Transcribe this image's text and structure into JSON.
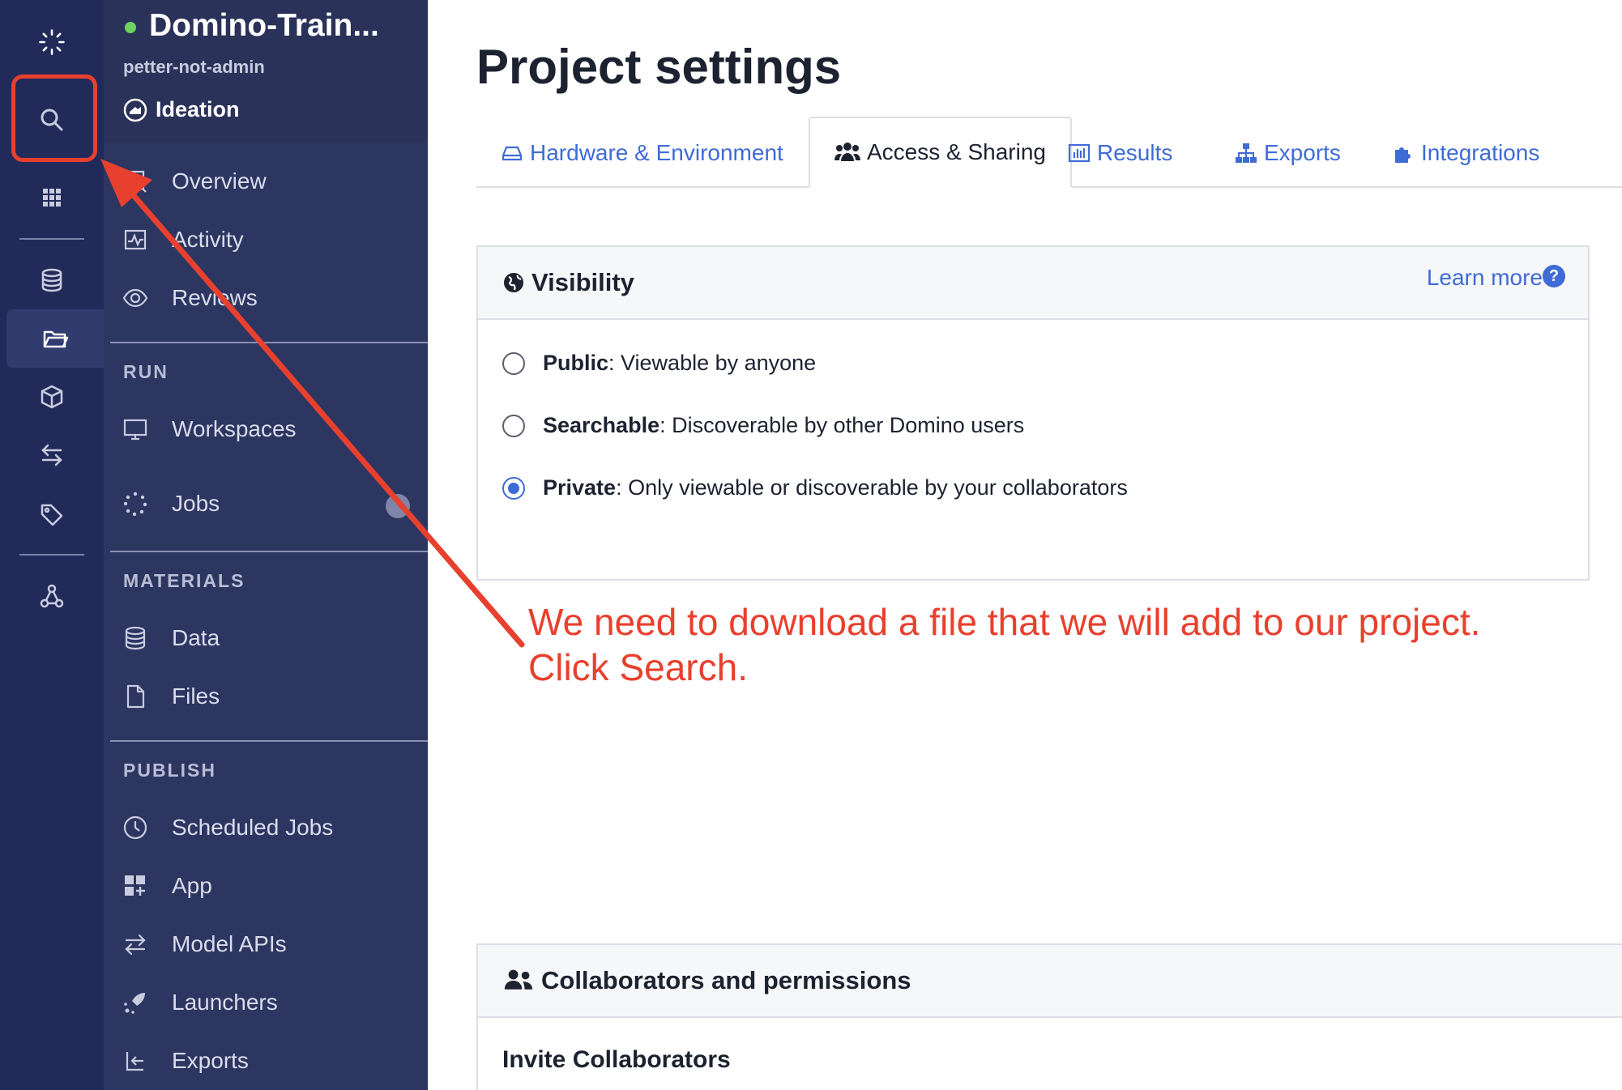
{
  "rail": {
    "items": [
      {
        "name": "domino-logo-icon"
      },
      {
        "name": "search-icon"
      },
      {
        "name": "apps-grid-icon"
      },
      {
        "name": "data-database-icon"
      },
      {
        "name": "projects-folder-icon"
      },
      {
        "name": "model-cube-icon"
      },
      {
        "name": "transfer-arrows-icon"
      },
      {
        "name": "tag-icon"
      },
      {
        "name": "network-icon"
      }
    ]
  },
  "project": {
    "name": "Domino-Train...",
    "owner": "petter-not-admin",
    "stage": "Ideation"
  },
  "sidebar": {
    "nav_top": [
      {
        "label": "Overview",
        "icon": "overview-icon"
      },
      {
        "label": "Activity",
        "icon": "activity-icon"
      },
      {
        "label": "Reviews",
        "icon": "eye-icon"
      }
    ],
    "run_label": "RUN",
    "run": [
      {
        "label": "Workspaces",
        "icon": "monitor-icon"
      },
      {
        "label": "Jobs",
        "icon": "jobs-spinner-icon"
      }
    ],
    "materials_label": "MATERIALS",
    "materials": [
      {
        "label": "Data",
        "icon": "database-icon"
      },
      {
        "label": "Files",
        "icon": "file-icon"
      }
    ],
    "publish_label": "PUBLISH",
    "publish": [
      {
        "label": "Scheduled Jobs",
        "icon": "clock-icon"
      },
      {
        "label": "App",
        "icon": "app-icon"
      },
      {
        "label": "Model APIs",
        "icon": "arrows-icon"
      },
      {
        "label": "Launchers",
        "icon": "rocket-icon"
      },
      {
        "label": "Exports",
        "icon": "export-icon"
      }
    ]
  },
  "main": {
    "title": "Project settings",
    "tabs": [
      {
        "label": "Hardware & Environment",
        "icon": "hardware-icon"
      },
      {
        "label": "Access & Sharing",
        "icon": "users-icon",
        "active": true
      },
      {
        "label": "Results",
        "icon": "chart-icon"
      },
      {
        "label": "Exports",
        "icon": "sitemap-icon"
      },
      {
        "label": "Integrations",
        "icon": "puzzle-icon"
      }
    ],
    "visibility": {
      "title": "Visibility",
      "learn_more": "Learn more",
      "help": "?",
      "options": [
        {
          "label": "Public",
          "desc": ": Viewable by anyone",
          "checked": false
        },
        {
          "label": "Searchable",
          "desc": ": Discoverable by other Domino users",
          "checked": false
        },
        {
          "label": "Private",
          "desc": ": Only viewable or discoverable by your collaborators",
          "checked": true
        }
      ]
    },
    "collaborators": {
      "title": "Collaborators and permissions",
      "invite_title": "Invite Collaborators"
    }
  },
  "annotation": {
    "line1": "We need to download a file that we will add to our project.",
    "line2": "Click Search.",
    "color": "#e8402e"
  },
  "colors": {
    "rail_bg": "#222a5a",
    "sidebar_bg": "#2d3561",
    "link_blue": "#3f6bd6",
    "status_green": "#6fd361"
  }
}
